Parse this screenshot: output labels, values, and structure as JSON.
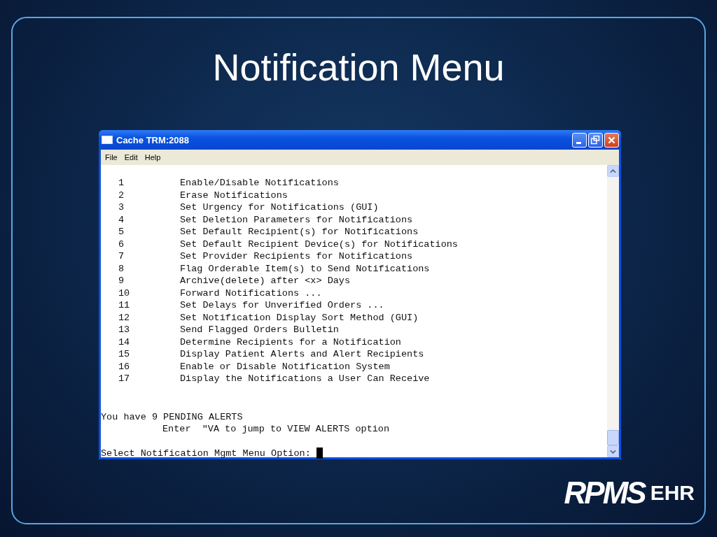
{
  "slide": {
    "title": "Notification Menu"
  },
  "window": {
    "title": "Cache TRM:2088",
    "menu": [
      "File",
      "Edit",
      "Help"
    ]
  },
  "terminal": {
    "items": [
      {
        "number": "1",
        "label": "Enable/Disable Notifications"
      },
      {
        "number": "2",
        "label": "Erase Notifications"
      },
      {
        "number": "3",
        "label": "Set Urgency for Notifications (GUI)"
      },
      {
        "number": "4",
        "label": "Set Deletion Parameters for Notifications"
      },
      {
        "number": "5",
        "label": "Set Default Recipient(s) for Notifications"
      },
      {
        "number": "6",
        "label": "Set Default Recipient Device(s) for Notifications"
      },
      {
        "number": "7",
        "label": "Set Provider Recipients for Notifications"
      },
      {
        "number": "8",
        "label": "Flag Orderable Item(s) to Send Notifications"
      },
      {
        "number": "9",
        "label": "Archive(delete) after <x> Days"
      },
      {
        "number": "10",
        "label": "Forward Notifications ..."
      },
      {
        "number": "11",
        "label": "Set Delays for Unverified Orders ..."
      },
      {
        "number": "12",
        "label": "Set Notification Display Sort Method (GUI)"
      },
      {
        "number": "13",
        "label": "Send Flagged Orders Bulletin"
      },
      {
        "number": "14",
        "label": "Determine Recipients for a Notification"
      },
      {
        "number": "15",
        "label": "Display Patient Alerts and Alert Recipients"
      },
      {
        "number": "16",
        "label": "Enable or Disable Notification System"
      },
      {
        "number": "17",
        "label": "Display the Notifications a User Can Receive"
      }
    ],
    "alert_message": "You have 9 PENDING ALERTS",
    "hint": "Enter  \"VA to jump to VIEW ALERTS option",
    "prompt": "Select Notification Mgmt Menu Option:"
  },
  "logo": {
    "primary": "RPMS",
    "secondary": "EHR"
  }
}
